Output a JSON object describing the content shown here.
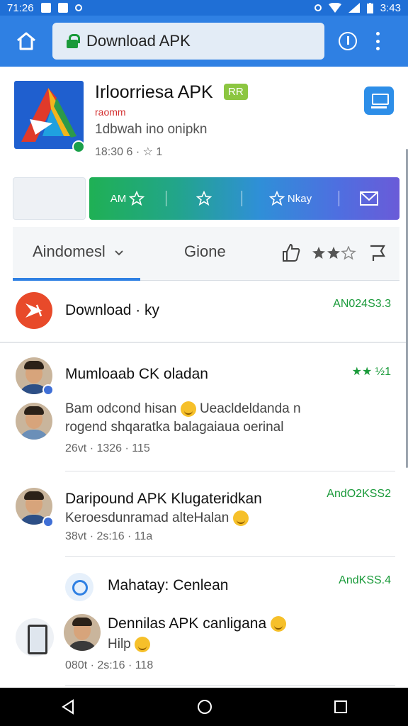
{
  "status_bar": {
    "time_left": "71:26",
    "icons_left": [
      "photo-icon",
      "signal-icon",
      "record-icon"
    ],
    "icons_right": [
      "alarm-icon",
      "wifi-icon",
      "signal-icon",
      "battery-icon"
    ],
    "time_right": "3:43"
  },
  "browser": {
    "url_text": "Download APK"
  },
  "app": {
    "title": "Irloorriesa APK",
    "tag": "RR",
    "developer": "raomm",
    "description": "1dbwah ino onipkn",
    "meta": "18:30 6 · ☆ 1"
  },
  "actions": {
    "seg1_label": "AM",
    "seg3_label": "Nkay"
  },
  "tabs": {
    "tab1": "Aindomesl",
    "tab2": "Gione"
  },
  "download": {
    "label": "Download · ky",
    "version": "AN024S3.3"
  },
  "comments": [
    {
      "title": "Mumloaab CK oladan",
      "rating": "★★ ½1",
      "text1": "Bam odcond hisan",
      "text1_tail": "Ueacldeldanda n",
      "text2": "rogend shqaratka balagaiaua oerinal",
      "meta": "26vt · 1326 · 115"
    },
    {
      "title": "Daripound APK Klugateridkan",
      "version": "AndO2KSS2",
      "text1": "Keroesdunramad alteHalan",
      "meta": "38vt · 2s:16 · 11a"
    },
    {
      "title": "Mahatay: Cenlean",
      "version": "AndKSS.4"
    },
    {
      "title": "Dennilas APK canligana",
      "text1": "Hilp",
      "meta": "080t · 2s:16 · 118"
    }
  ]
}
